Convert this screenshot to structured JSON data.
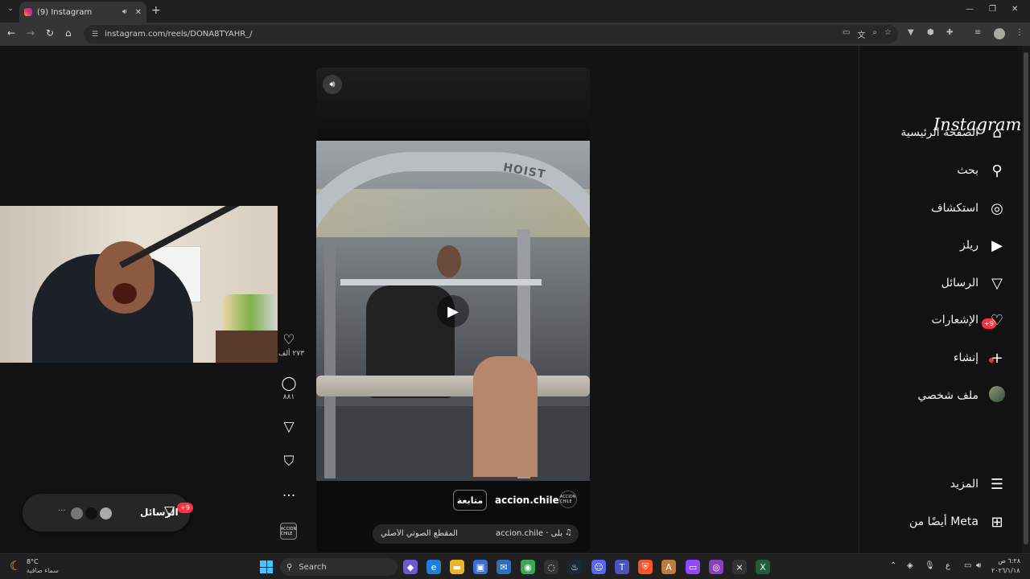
{
  "browser": {
    "tab_title": "(9) Instagram",
    "tab_audio_icon": "speaker-icon",
    "url": "instagram.com/reels/DONA8TYAHR_/"
  },
  "reel": {
    "account": "accion.chile",
    "account_logo_text": "ACCION CHILE",
    "follow_label": "متابعة",
    "audio_account": "accion.chile · بلى",
    "audio_label": "المقطع الصوتي الأصلي",
    "video_brand": "HOIST",
    "play_icon": "▶"
  },
  "actions": {
    "likes": "٢٧٣ ألف",
    "comments": "٨٨١"
  },
  "messages_pill": {
    "label": "الرسائل",
    "badge": "+9",
    "more": "···"
  },
  "sidebar": {
    "logo": "Instagram",
    "items": [
      {
        "label": "الصفحة الرئيسية",
        "icon": "home-icon"
      },
      {
        "label": "بحث",
        "icon": "search-icon"
      },
      {
        "label": "استكشاف",
        "icon": "compass-icon"
      },
      {
        "label": "ريلز",
        "icon": "reels-icon"
      },
      {
        "label": "الرسائل",
        "icon": "send-icon"
      },
      {
        "label": "الإشعارات",
        "icon": "heart-icon"
      },
      {
        "label": "إنشاء",
        "icon": "plus-icon"
      },
      {
        "label": "ملف شخصي",
        "icon": "avatar"
      },
      {
        "label": "المزيد",
        "icon": "menu-icon"
      },
      {
        "label": "أيضًا من Meta",
        "icon": "meta-grid-icon"
      }
    ],
    "messages_badge": "+9"
  },
  "taskbar": {
    "temperature": "8°C",
    "condition": "سماء صافية",
    "search_placeholder": "Search",
    "time": "٦:٢٨ ص",
    "date": "٢٠٢٦/١/١٨",
    "lang": "ع"
  },
  "colors": {
    "accent_badge": "#ff3040",
    "background": "#121212"
  }
}
